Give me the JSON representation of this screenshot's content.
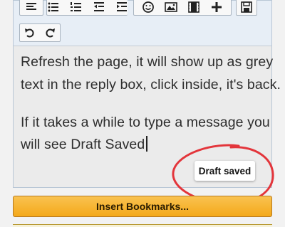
{
  "editor": {
    "lines": [
      "Refresh the page, it will show up as grey",
      "text in the reply box, click inside, it's back.",
      "If it takes a while to type a message you",
      "will see Draft Saved"
    ]
  },
  "status": {
    "draft_label": "Draft saved"
  },
  "actions": {
    "insert_bookmarks_label": "Insert Bookmarks..."
  },
  "toolbar": {
    "buttons": [
      "align-icon",
      "bullet-list-icon",
      "numbered-list-icon",
      "outdent-icon",
      "indent-icon",
      "smiley-icon",
      "image-icon",
      "video-icon",
      "plus-icon",
      "save-icon",
      "undo-icon",
      "redo-icon"
    ]
  },
  "colors": {
    "highlight_circle": "#e3353b",
    "button_accent": "#f4a91a"
  }
}
